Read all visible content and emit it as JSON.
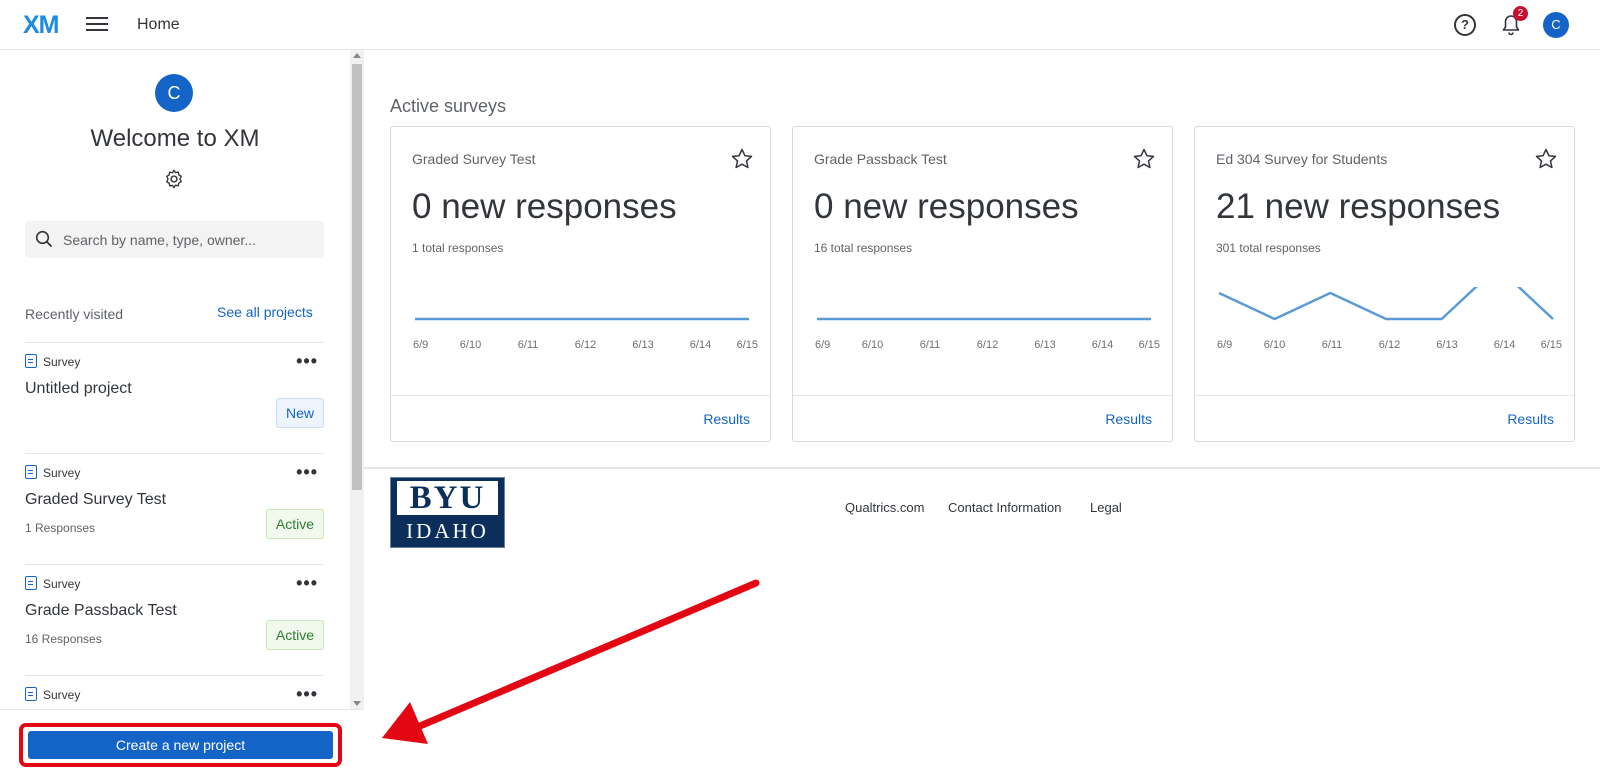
{
  "header": {
    "logo": "XM",
    "page": "Home",
    "help_icon_glyph": "?",
    "notification_count": "2",
    "avatar_initial": "C"
  },
  "sidebar": {
    "avatar_initial": "C",
    "welcome": "Welcome to XM",
    "search_placeholder": "Search by name, type, owner...",
    "recently_visited": "Recently visited",
    "see_all": "See all projects",
    "projects": [
      {
        "type": "Survey",
        "name": "Untitled project",
        "responses": "",
        "status": "New"
      },
      {
        "type": "Survey",
        "name": "Graded Survey Test",
        "responses": "1 Responses",
        "status": "Active"
      },
      {
        "type": "Survey",
        "name": "Grade Passback Test",
        "responses": "16 Responses",
        "status": "Active"
      },
      {
        "type": "Survey",
        "name": "",
        "responses": "",
        "status": ""
      }
    ],
    "more_glyph": "•••",
    "create_button": "Create a new project"
  },
  "main": {
    "section_title": "Active surveys",
    "cards": [
      {
        "title": "Graded Survey Test",
        "new_responses": "0 new responses",
        "total": "1 total responses",
        "x": [
          "6/9",
          "6/10",
          "6/11",
          "6/12",
          "6/13",
          "6/14",
          "6/15"
        ],
        "values": [
          0,
          0,
          0,
          0,
          0,
          0,
          0
        ],
        "results": "Results"
      },
      {
        "title": "Grade Passback Test",
        "new_responses": "0 new responses",
        "total": "16 total responses",
        "x": [
          "6/9",
          "6/10",
          "6/11",
          "6/12",
          "6/13",
          "6/14",
          "6/15"
        ],
        "values": [
          0,
          0,
          0,
          0,
          0,
          0,
          0
        ],
        "results": "Results"
      },
      {
        "title": "Ed 304 Survey for Students",
        "new_responses": "21 new responses",
        "total": "301 total responses",
        "x": [
          "6/9",
          "6/10",
          "6/11",
          "6/12",
          "6/13",
          "6/14",
          "6/15"
        ],
        "values": [
          5,
          0,
          5,
          0,
          0,
          10,
          0
        ],
        "results": "Results"
      }
    ],
    "line_color": "#5b9bd5",
    "logo_top": "BYU",
    "logo_bottom": "IDAHO",
    "footer_links": [
      "Qualtrics.com",
      "Contact Information",
      "Legal"
    ]
  },
  "colors": {
    "accent": "#1464c8",
    "annotation_red": "#e30613"
  }
}
